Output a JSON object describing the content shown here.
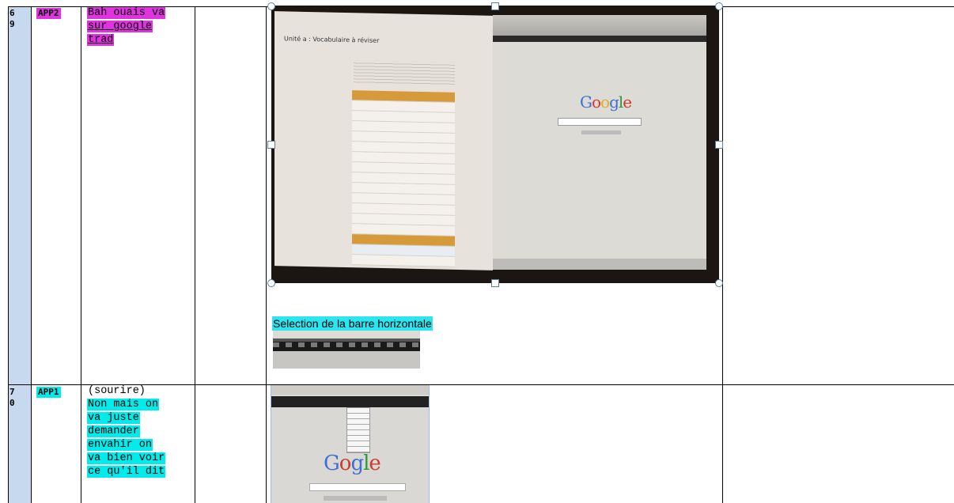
{
  "rows": [
    {
      "number": "6\n9",
      "speaker": "APP2",
      "speaker_highlight": "#e033e0",
      "speech_lines": [
        "Bah ouais va",
        "sur google",
        "trad"
      ],
      "caption": "Selection de la barre horizontale"
    },
    {
      "number": "7\n0",
      "speaker": "APP1",
      "speaker_highlight": "#00ecec",
      "speech_lines": [
        "(sourire)",
        "Non mais on",
        "va juste",
        "demander",
        "envahir on",
        "va bien voir",
        "ce qu'il dit"
      ]
    }
  ],
  "screenshot": {
    "document_title": "Unité a : Vocabulaire à réviser",
    "search_logo": "Google"
  },
  "colors": {
    "number_column": "#c6d9ee",
    "highlight_magenta": "#e033e0",
    "highlight_cyan": "#00ecec",
    "selection_handle_border": "#5a7fa8"
  }
}
